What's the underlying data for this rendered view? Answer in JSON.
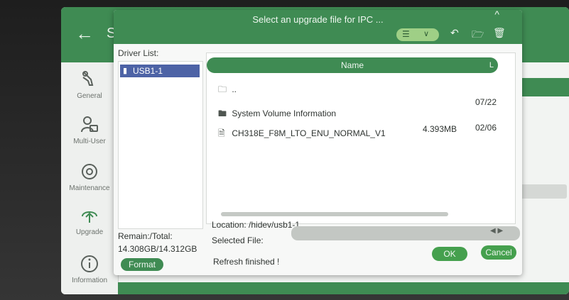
{
  "app": {
    "back_icon": "back-arrow-icon",
    "title_peek": "S"
  },
  "sidebar": {
    "items": [
      {
        "label": "General",
        "icon": "wrench-icon"
      },
      {
        "label": "Multi-User",
        "icon": "multi-user-icon"
      },
      {
        "label": "Maintenance",
        "icon": "maintenance-gear-icon"
      },
      {
        "label": "Upgrade",
        "icon": "upgrade-icon"
      },
      {
        "label": "Information",
        "icon": "info-icon"
      }
    ]
  },
  "dialog": {
    "title": "Select an upgrade file for IPC ...",
    "collapse_symbol": "^",
    "driver_list_label": "Driver List:",
    "drivers": [
      {
        "label": "USB1-1",
        "selected": true
      }
    ],
    "column_name": "Name",
    "column_corner": "L",
    "rows": [
      {
        "icon": "folder-up-icon",
        "name": "..",
        "size": "",
        "date": ""
      },
      {
        "icon": "folder-icon",
        "name": "System Volume Information",
        "size": "",
        "date": "07/22"
      },
      {
        "icon": "file-icon",
        "name": "CH318E_F8M_LTO_ENU_NORMAL_V1",
        "size": "4.393MB",
        "date": "02/06"
      }
    ],
    "remain_label": "Remain:/Total:",
    "remain_value": "14.308GB/14.312GB",
    "format_label": "Format",
    "location_label": "Location: /hidev/usb1-1",
    "selected_file_label": "Selected File:",
    "selected_file_value": "",
    "status": "Refresh finished !",
    "ok_label": "OK",
    "cancel_label": "Cancel"
  },
  "colors": {
    "accent_green": "#3f8b53",
    "selection_blue": "#4d63a6",
    "button_green": "#45a04e"
  }
}
